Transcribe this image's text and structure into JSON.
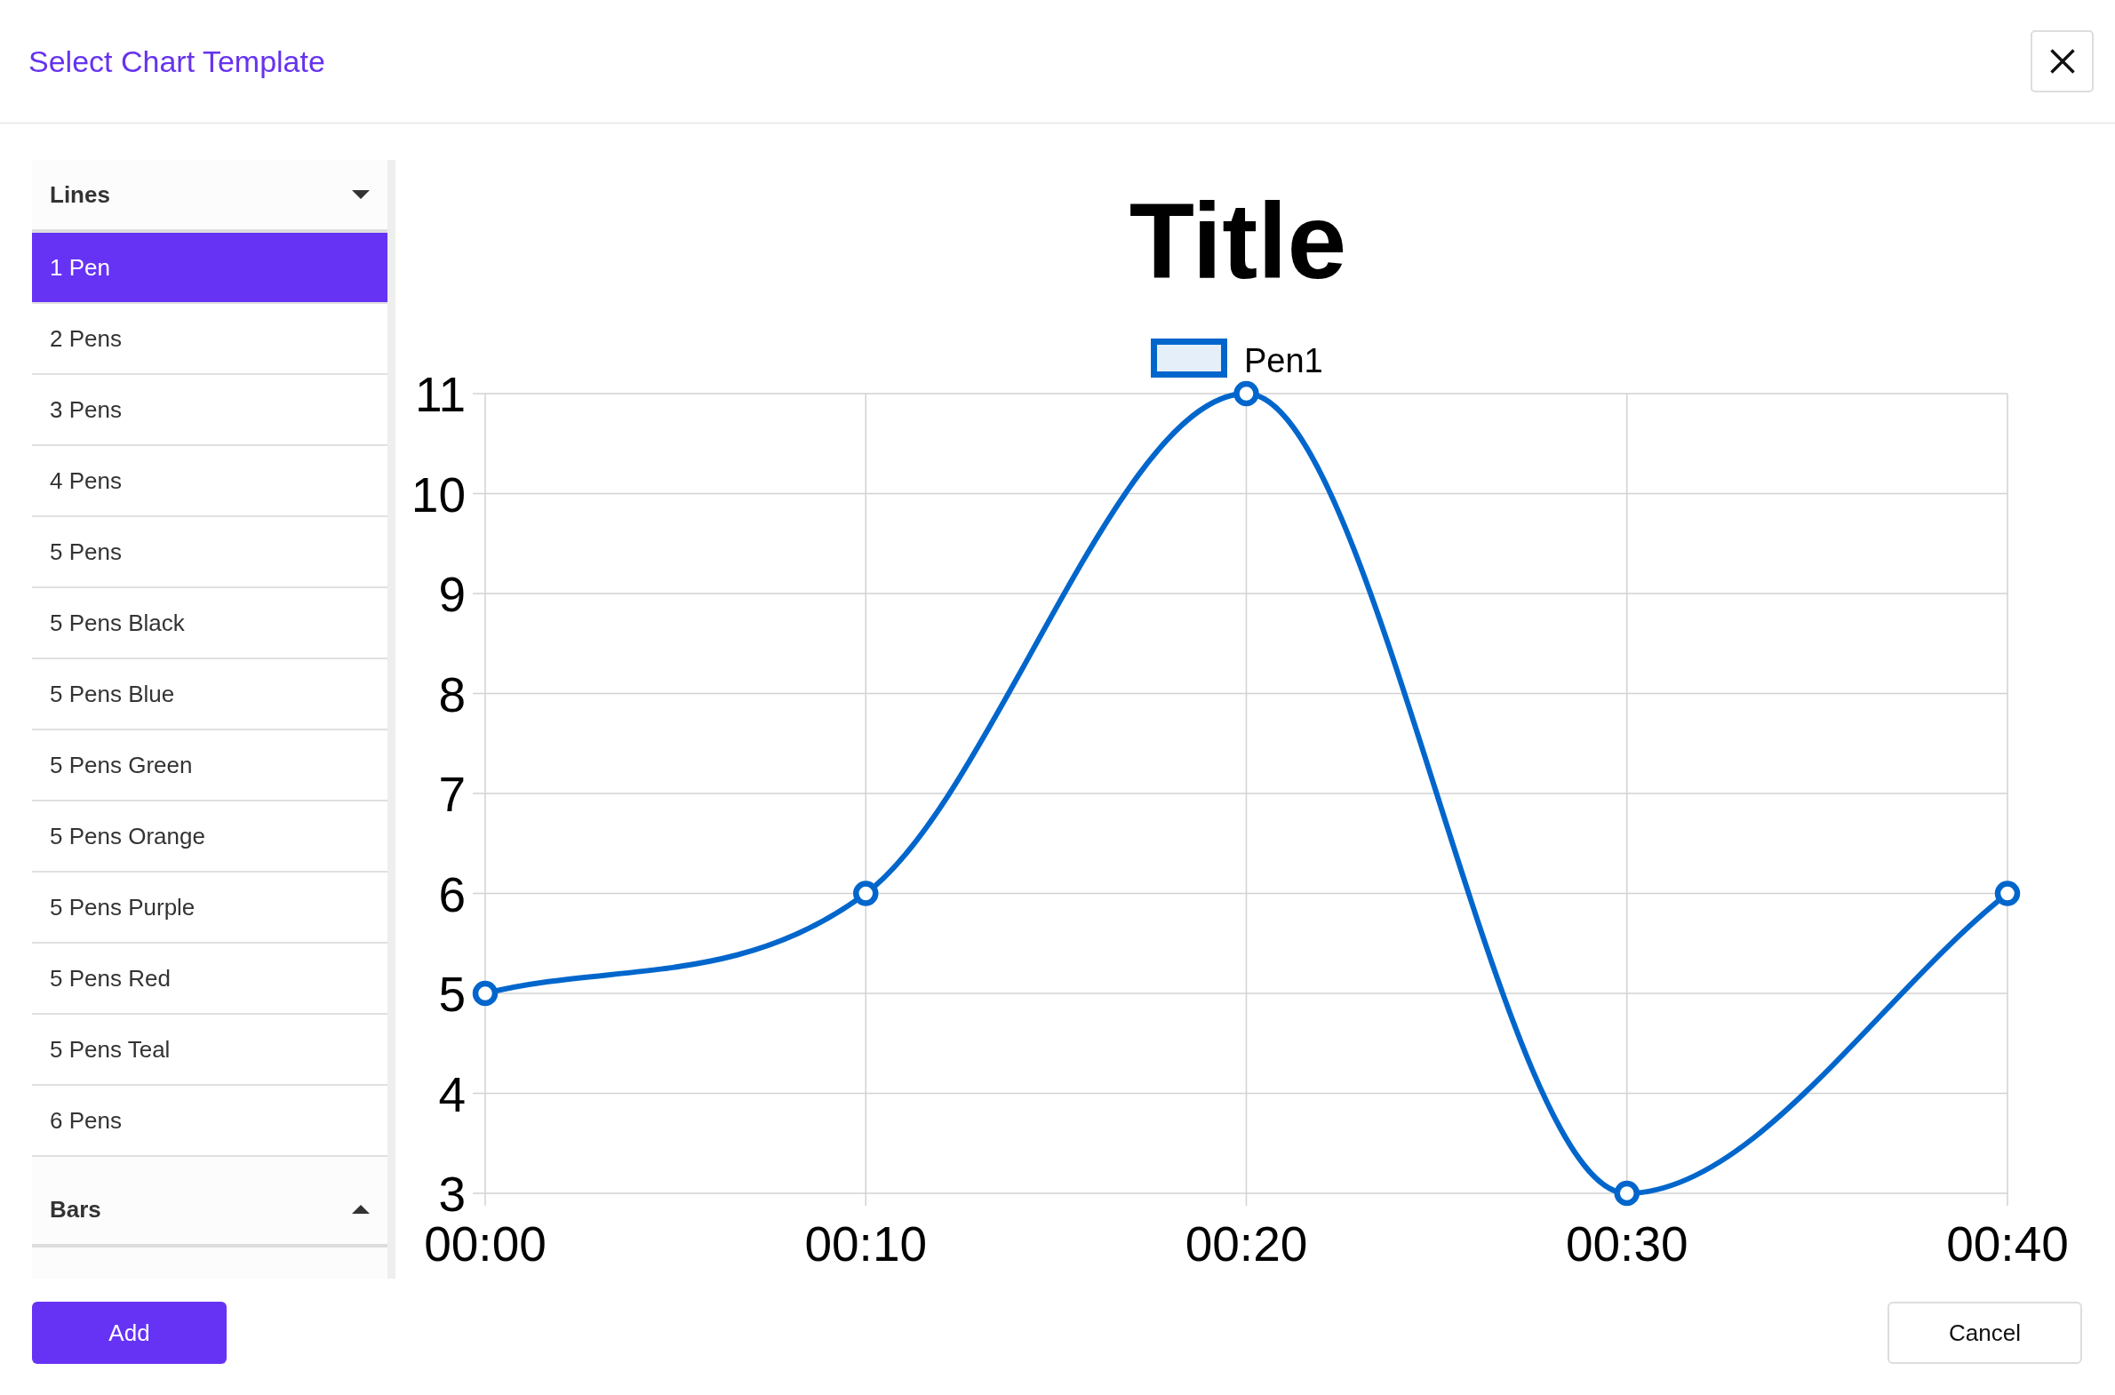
{
  "dialog": {
    "title": "Select Chart Template"
  },
  "sidebar": {
    "groups": [
      {
        "label": "Lines",
        "expanded": true,
        "items": [
          {
            "label": "1 Pen",
            "selected": true
          },
          {
            "label": "2 Pens",
            "selected": false
          },
          {
            "label": "3 Pens",
            "selected": false
          },
          {
            "label": "4 Pens",
            "selected": false
          },
          {
            "label": "5 Pens",
            "selected": false
          },
          {
            "label": "5 Pens Black",
            "selected": false
          },
          {
            "label": "5 Pens Blue",
            "selected": false
          },
          {
            "label": "5 Pens Green",
            "selected": false
          },
          {
            "label": "5 Pens Orange",
            "selected": false
          },
          {
            "label": "5 Pens Purple",
            "selected": false
          },
          {
            "label": "5 Pens Red",
            "selected": false
          },
          {
            "label": "5 Pens Teal",
            "selected": false
          },
          {
            "label": "6 Pens",
            "selected": false
          }
        ]
      },
      {
        "label": "Bars",
        "expanded": false
      }
    ]
  },
  "preview": {
    "chart_data": {
      "type": "line",
      "title": "Title",
      "categories": [
        "00:00",
        "00:10",
        "00:20",
        "00:30",
        "00:40"
      ],
      "series": [
        {
          "name": "Pen1",
          "color": "#0066cc",
          "marker": true,
          "values": [
            5,
            6,
            11,
            3,
            6
          ]
        }
      ],
      "ylim": [
        3,
        11
      ],
      "yticks": [
        3,
        4,
        5,
        6,
        7,
        8,
        9,
        10,
        11
      ],
      "grid": true
    }
  },
  "buttons": [
    {
      "label": "Add",
      "kind": "primary"
    },
    {
      "label": "Cancel",
      "kind": "secondary"
    }
  ]
}
